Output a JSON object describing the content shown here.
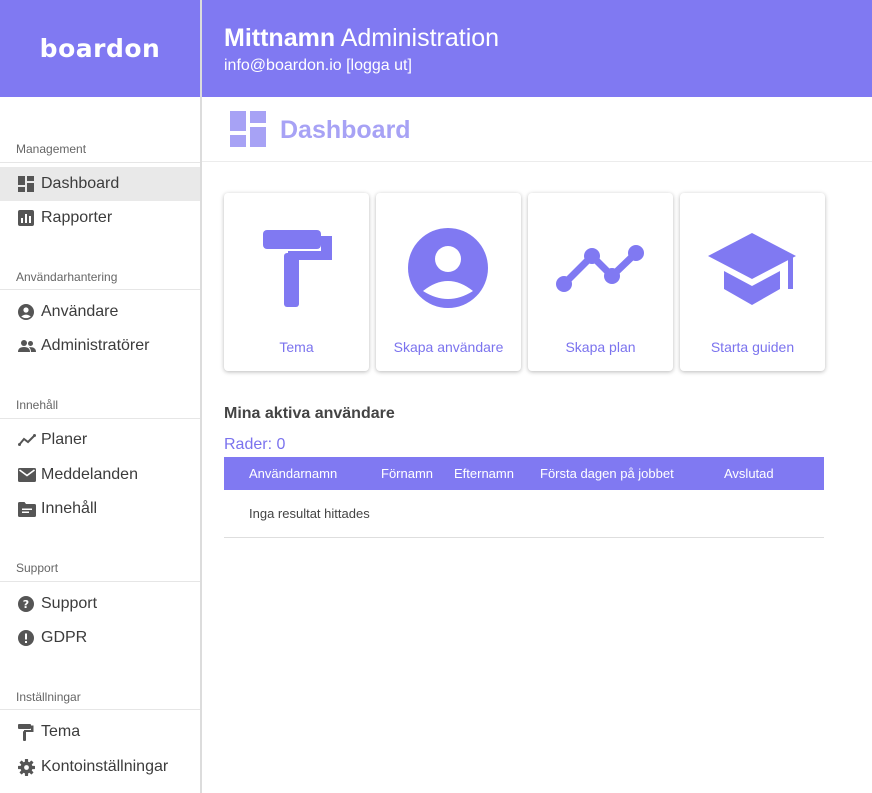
{
  "brand": {
    "logo": "boardon",
    "accent": "#8079f2"
  },
  "header": {
    "name": "Mittnamn",
    "title_suffix": "Administration",
    "email": "info@boardon.io [logga ut]"
  },
  "sidebar": {
    "sections": [
      {
        "title": "Management",
        "items": [
          {
            "label": "Dashboard",
            "icon": "dashboard-icon",
            "active": true
          },
          {
            "label": "Rapporter",
            "icon": "bar-chart-icon"
          }
        ]
      },
      {
        "title": "Användarhantering",
        "items": [
          {
            "label": "Användare",
            "icon": "account-circle-icon"
          },
          {
            "label": "Administratörer",
            "icon": "people-icon"
          }
        ]
      },
      {
        "title": "Innehåll",
        "items": [
          {
            "label": "Planer",
            "icon": "timeline-icon"
          },
          {
            "label": "Meddelanden",
            "icon": "mail-icon"
          },
          {
            "label": "Innehåll",
            "icon": "folder-icon"
          }
        ]
      },
      {
        "title": "Support",
        "items": [
          {
            "label": "Support",
            "icon": "help-icon"
          },
          {
            "label": "GDPR",
            "icon": "alert-icon"
          }
        ]
      },
      {
        "title": "Inställningar",
        "items": [
          {
            "label": "Tema",
            "icon": "paint-roller-icon"
          },
          {
            "label": "Kontoinställningar",
            "icon": "gear-icon"
          }
        ]
      }
    ]
  },
  "page": {
    "title": "Dashboard"
  },
  "cards": [
    {
      "label": "Tema",
      "icon": "paint-roller-icon"
    },
    {
      "label": "Skapa användare",
      "icon": "account-circle-icon"
    },
    {
      "label": "Skapa plan",
      "icon": "timeline-icon"
    },
    {
      "label": "Starta guiden",
      "icon": "graduation-cap-icon"
    }
  ],
  "users": {
    "heading": "Mina aktiva användare",
    "rows_label": "Rader: 0",
    "columns": [
      "Användarnamn",
      "Förnamn",
      "Efternamn",
      "Första dagen på jobbet",
      "Avslutad"
    ],
    "empty_text": "Inga resultat hittades"
  }
}
